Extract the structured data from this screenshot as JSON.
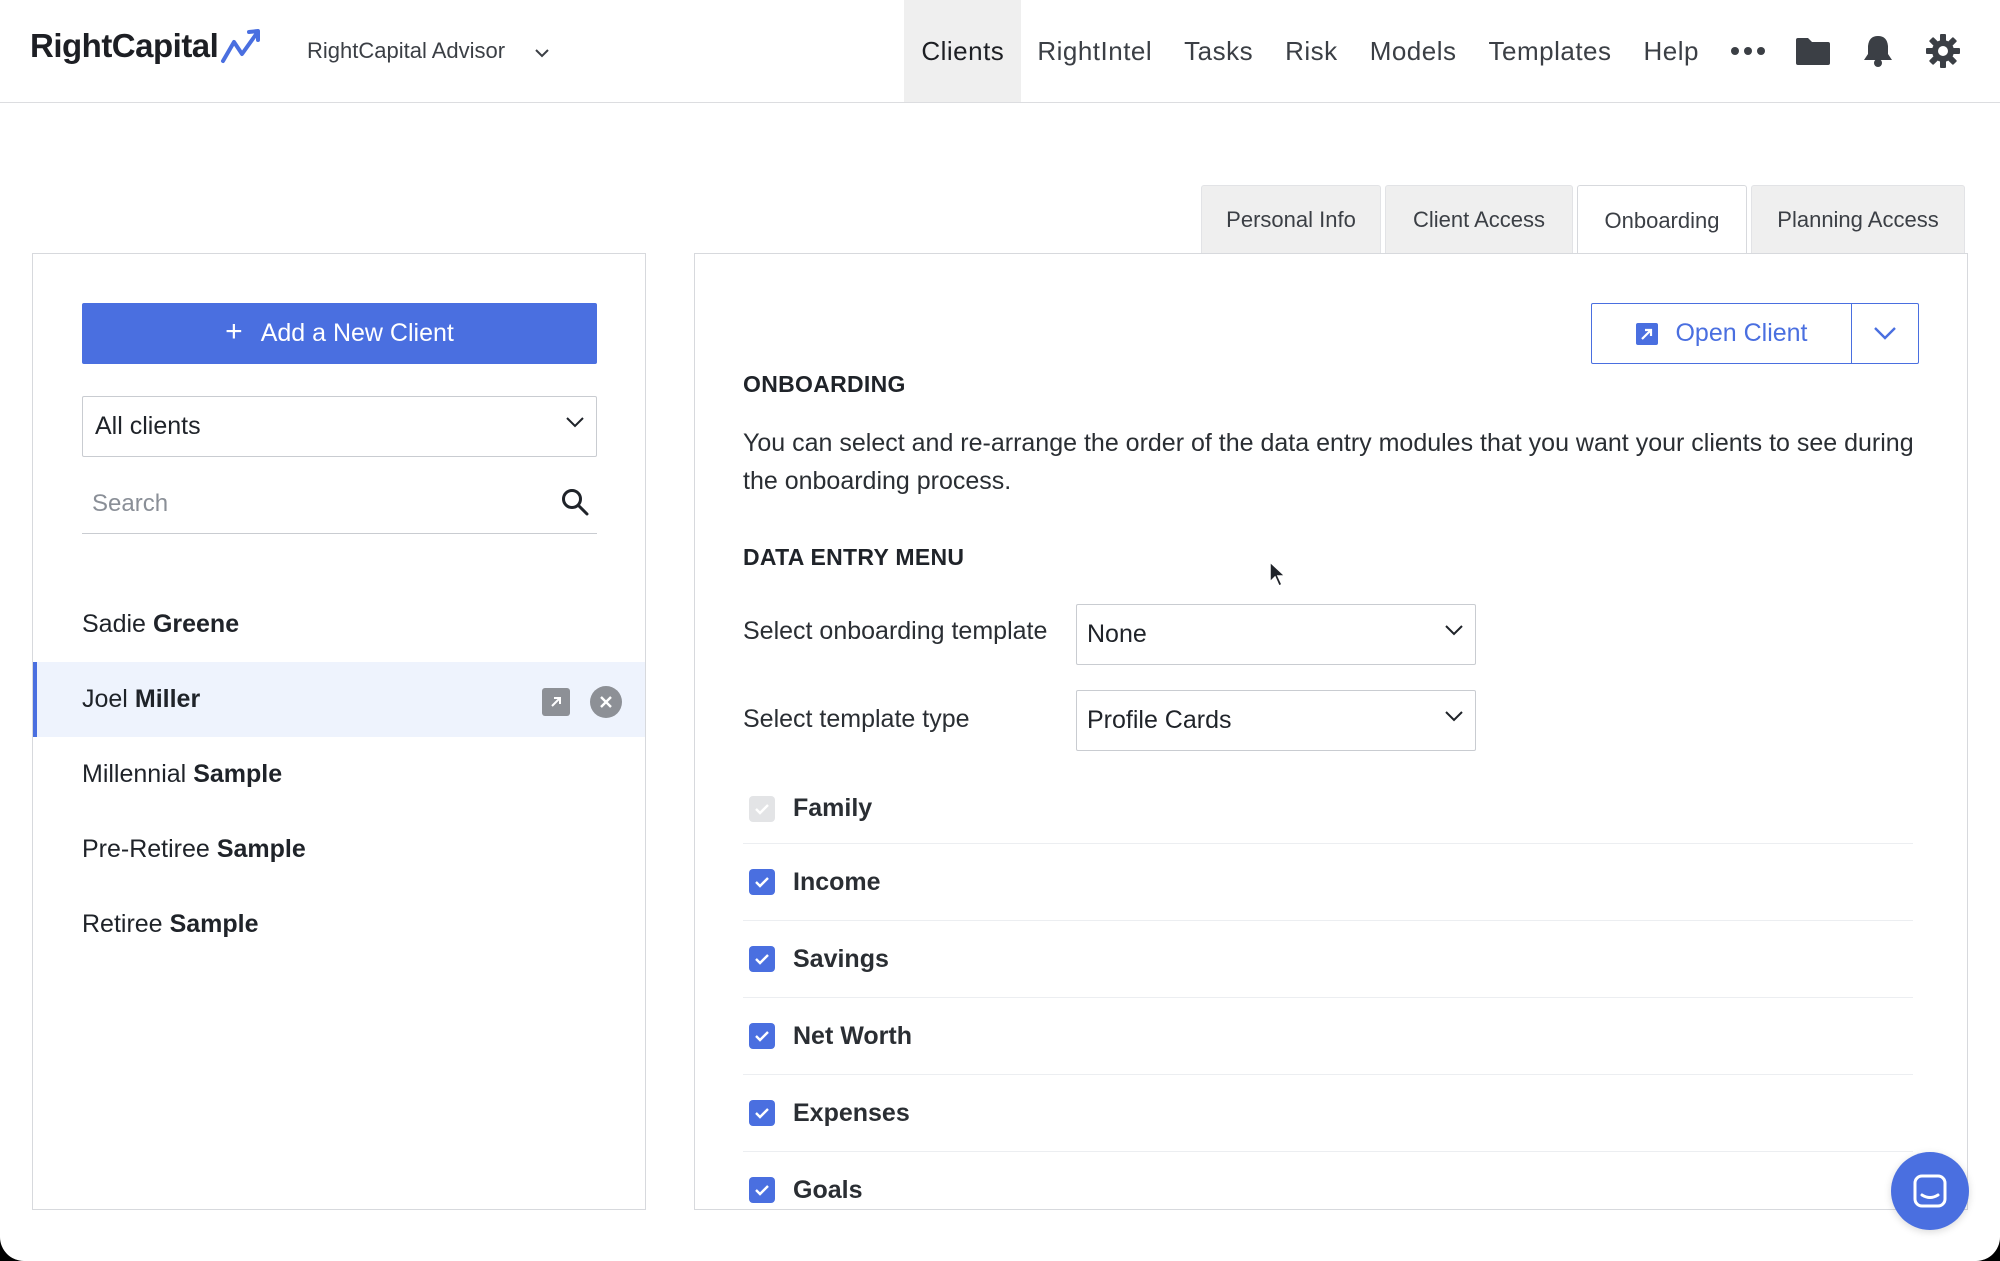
{
  "brand": {
    "logo_text": "RightCapital",
    "accent": "#4a6fe0"
  },
  "header": {
    "advisor_label": "RightCapital Advisor",
    "nav": [
      "Clients",
      "RightIntel",
      "Tasks",
      "Risk",
      "Models",
      "Templates",
      "Help"
    ],
    "active_nav": "Clients",
    "icons": [
      "more-icon",
      "folder-icon",
      "bell-icon",
      "gear-icon"
    ]
  },
  "left": {
    "add_button": "Add a New Client",
    "filter_value": "All clients",
    "search_placeholder": "Search",
    "clients": [
      {
        "first": "Sadie",
        "last": "Greene",
        "selected": false
      },
      {
        "first": "Joel",
        "last": "Miller",
        "selected": true
      },
      {
        "first": "Millennial",
        "last": "Sample",
        "selected": false
      },
      {
        "first": "Pre-Retiree",
        "last": "Sample",
        "selected": false
      },
      {
        "first": "Retiree",
        "last": "Sample",
        "selected": false
      }
    ]
  },
  "tabs": [
    "Personal Info",
    "Client Access",
    "Onboarding",
    "Planning Access"
  ],
  "active_tab": "Onboarding",
  "main": {
    "open_client_button": "Open Client",
    "onboarding_title": "ONBOARDING",
    "onboarding_desc": "You can select and re-arrange the order of the data entry modules that you want your clients to see during the onboarding process.",
    "data_entry_title": "DATA ENTRY MENU",
    "template_label": "Select onboarding template",
    "template_value": "None",
    "type_label": "Select template type",
    "type_value": "Profile Cards",
    "modules": [
      {
        "label": "Family",
        "checked": true,
        "disabled": true
      },
      {
        "label": "Income",
        "checked": true,
        "disabled": false
      },
      {
        "label": "Savings",
        "checked": true,
        "disabled": false
      },
      {
        "label": "Net Worth",
        "checked": true,
        "disabled": false
      },
      {
        "label": "Expenses",
        "checked": true,
        "disabled": false
      },
      {
        "label": "Goals",
        "checked": true,
        "disabled": false
      }
    ]
  }
}
